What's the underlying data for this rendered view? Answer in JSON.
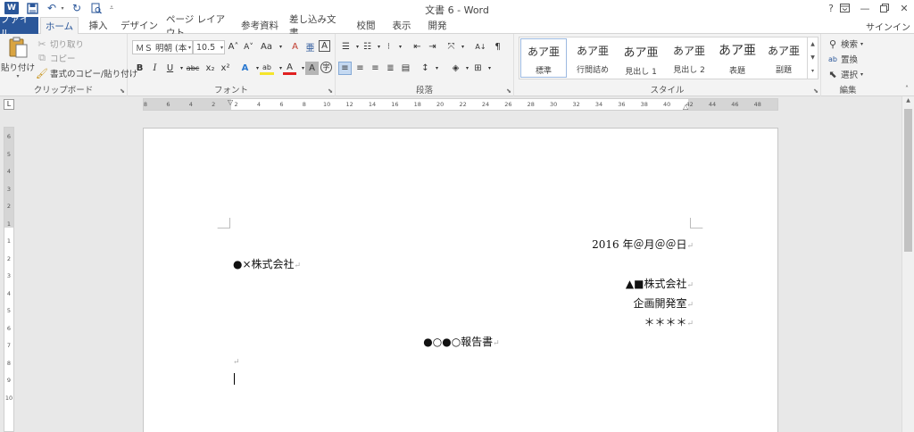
{
  "titlebar": {
    "title": "文書 6 - Word",
    "app_icon": "W",
    "qat": [
      "save-icon",
      "undo-icon",
      "redo-icon",
      "print-preview-icon",
      "customize-icon"
    ],
    "window_buttons": [
      "?",
      "⊡",
      "—",
      "▭",
      "✕"
    ]
  },
  "tabs": {
    "file": "ファイル",
    "items": [
      "ホーム",
      "挿入",
      "デザイン",
      "ページ レイアウト",
      "参考資料",
      "差し込み文書",
      "校閲",
      "表示",
      "開発"
    ],
    "active": "ホーム",
    "signin": "サインイン"
  },
  "ribbon": {
    "clipboard": {
      "label": "クリップボード",
      "paste": "貼り付け",
      "cut": "切り取り",
      "copy": "コピー",
      "format_painter": "書式のコピー/貼り付け"
    },
    "font": {
      "label": "フォント",
      "font_name": "ＭＳ 明朝 (本",
      "font_size": "10.5",
      "bold": "B",
      "italic": "I",
      "underline": "U",
      "strike": "abc",
      "subscript": "x₂",
      "superscript": "x²",
      "grow": "A˄",
      "shrink": "A˅",
      "case": "Aa",
      "clear": "A",
      "ruby": "亜",
      "border_char": "A",
      "effects": "A",
      "highlight": "ab",
      "color": "A",
      "shading": "A",
      "enclose": "字"
    },
    "paragraph": {
      "label": "段落"
    },
    "styles": {
      "label": "スタイル",
      "items": [
        {
          "sample": "あア亜",
          "name": "標準"
        },
        {
          "sample": "あア亜",
          "name": "行間詰め"
        },
        {
          "sample": "あア亜",
          "name": "見出し 1"
        },
        {
          "sample": "あア亜",
          "name": "見出し 2"
        },
        {
          "sample": "あア亜",
          "name": "表題"
        },
        {
          "sample": "あア亜",
          "name": "副題"
        }
      ]
    },
    "editing": {
      "label": "編集",
      "find": "検索",
      "replace": "置換",
      "select": "選択"
    }
  },
  "ruler": {
    "corner": "L",
    "h_ticks": [
      "8",
      "6",
      "4",
      "2",
      "2",
      "4",
      "6",
      "8",
      "10",
      "12",
      "14",
      "16",
      "18",
      "20",
      "22",
      "24",
      "26",
      "28",
      "30",
      "32",
      "34",
      "36",
      "38",
      "40",
      "42",
      "44",
      "46",
      "48"
    ],
    "v_ticks": [
      "6",
      "5",
      "4",
      "3",
      "2",
      "1",
      "1",
      "2",
      "3",
      "4",
      "5",
      "6",
      "7",
      "8",
      "9",
      "10"
    ]
  },
  "document": {
    "date": "2016 年＠月＠＠日",
    "recipient": "●×株式会社",
    "sender_company": "▲■株式会社",
    "sender_dept": "企画開発室",
    "sender_name": "＊＊＊＊",
    "title": "●○●○報告書",
    "para_mark": "↵"
  }
}
